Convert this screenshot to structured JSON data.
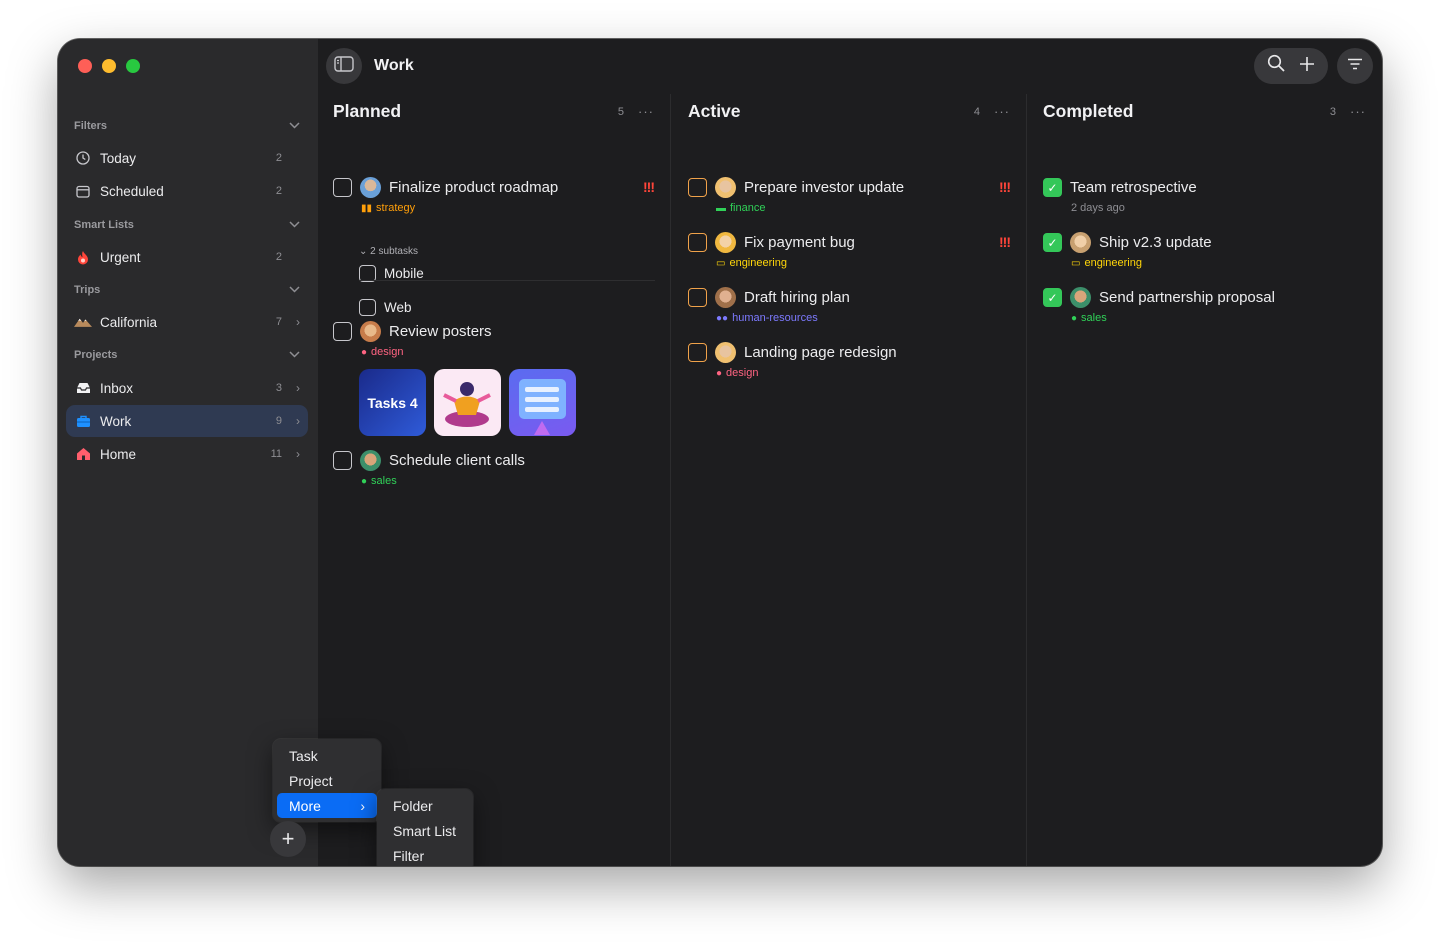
{
  "window": {
    "title": "Work"
  },
  "sidebar": {
    "sections": [
      {
        "label": "Filters"
      },
      {
        "label": "Smart Lists"
      },
      {
        "label": "Trips"
      },
      {
        "label": "Projects"
      }
    ],
    "items": [
      {
        "label": "Today",
        "count": "2",
        "icon": "clock-icon"
      },
      {
        "label": "Scheduled",
        "count": "2",
        "icon": "calendar-icon"
      },
      {
        "label": "Urgent",
        "count": "2",
        "icon": "flame-icon"
      },
      {
        "label": "California",
        "count": "7",
        "icon": "mountain-icon"
      },
      {
        "label": "Inbox",
        "count": "3",
        "icon": "inbox-icon"
      },
      {
        "label": "Work",
        "count": "9",
        "icon": "briefcase-icon"
      },
      {
        "label": "Home",
        "count": "11",
        "icon": "house-icon"
      }
    ]
  },
  "columns": [
    {
      "title": "Planned",
      "count": "5",
      "more": "···",
      "tasks": [
        {
          "title": "Finalize product roadmap",
          "tag": "strategy",
          "priority": "!!!"
        },
        {
          "subtasks_label": "2 subtasks",
          "subtasks": [
            "Mobile",
            "Web"
          ]
        },
        {
          "title": "Review posters",
          "tag": "design"
        },
        {
          "thumb_text": "Tasks 4"
        },
        {
          "title": "Schedule client calls",
          "tag": "sales"
        }
      ]
    },
    {
      "title": "Active",
      "count": "4",
      "more": "···",
      "tasks": [
        {
          "title": "Prepare investor update",
          "tag": "finance",
          "priority": "!!!"
        },
        {
          "title": "Fix payment bug",
          "tag": "engineering",
          "priority": "!!!"
        },
        {
          "title": "Draft hiring plan",
          "tag": "human-resources"
        },
        {
          "title": "Landing page redesign",
          "tag": "design"
        }
      ]
    },
    {
      "title": "Completed",
      "count": "3",
      "more": "···",
      "tasks": [
        {
          "title": "Team retrospective",
          "tag": "2 days ago"
        },
        {
          "title": "Ship v2.3 update",
          "tag": "engineering"
        },
        {
          "title": "Send partnership proposal",
          "tag": "sales"
        }
      ]
    }
  ],
  "add_menu": {
    "items": [
      "Task",
      "Project",
      "More"
    ],
    "submenu": [
      "Folder",
      "Smart List",
      "Filter"
    ]
  },
  "colors": {
    "accent": "#0a6cf5",
    "priority": "#ff453a",
    "complete": "#34c759",
    "active_checkbox": "#f0a24a"
  }
}
